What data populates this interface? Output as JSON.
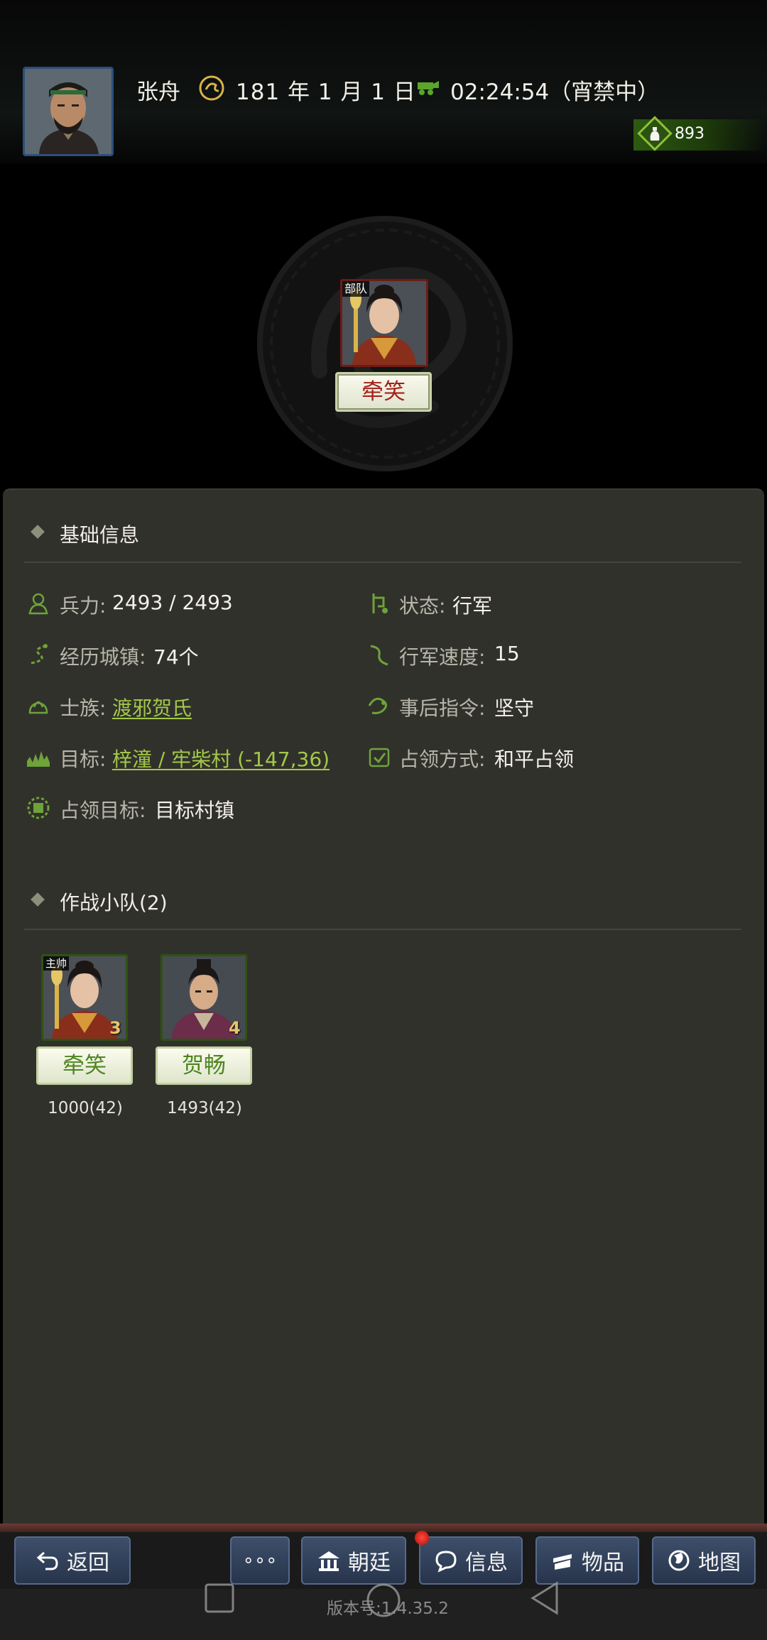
{
  "header": {
    "player_name": "张舟",
    "date": "181 年 1 月 1 日",
    "time": "02:24:54（宵禁中）",
    "gold": "893"
  },
  "unit": {
    "badge": "部队",
    "name": "牵笑"
  },
  "basic_info": {
    "title": "基础信息",
    "troops_label": "兵力:",
    "troops_value": "2493 / 2493",
    "status_label": "状态:",
    "status_value": "行军",
    "towns_label": "经历城镇:",
    "towns_value": "74个",
    "speed_label": "行军速度:",
    "speed_value": "15",
    "clan_label": "士族:",
    "clan_value": "渡邪贺氏",
    "after_label": "事后指令:",
    "after_value": "坚守",
    "target_label": "目标:",
    "target_value": "梓潼 / 牢柴村 (-147,36)",
    "occupy_mode_label": "占领方式:",
    "occupy_mode_value": "和平占领",
    "occupy_target_label": "占领目标:",
    "occupy_target_value": "目标村镇"
  },
  "squad": {
    "title": "作战小队(2)",
    "members": [
      {
        "tag": "主帅",
        "name": "牵笑",
        "level": "3",
        "troops": "1000(42)"
      },
      {
        "tag": "",
        "name": "贺畅",
        "level": "4",
        "troops": "1493(42)"
      }
    ]
  },
  "nav": {
    "back": "返回",
    "more": "∘∘∘",
    "court": "朝廷",
    "info": "信息",
    "items": "物品",
    "map": "地图"
  },
  "version": "版本号:1.4.35.2",
  "colors": {
    "panel_bg": "#31312b",
    "link": "#a2c84a",
    "nav_button": "#33435d",
    "unit_name": "#a3201a",
    "squad_name": "#4e8520"
  }
}
